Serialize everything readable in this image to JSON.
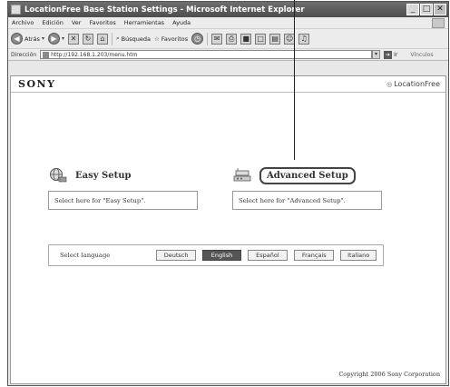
{
  "window": {
    "title": "LocationFree Base Station Settings - Microsoft Internet Explorer",
    "controls": {
      "minimize": "_",
      "maximize": "□",
      "close": "✕"
    }
  },
  "menubar": {
    "items": [
      "Archivo",
      "Edición",
      "Ver",
      "Favoritos",
      "Herramientas",
      "Ayuda"
    ]
  },
  "toolbar": {
    "back_label": "Atrás",
    "search_label": "Búsqueda",
    "favorites_label": "Favoritos"
  },
  "addressbar": {
    "label": "Dirección",
    "url": "http://192.168.1.203/menu.htm",
    "go_label": "Ir",
    "links_label": "Vínculos"
  },
  "page": {
    "brand": "SONY",
    "product_logo": "LocationFree",
    "easy_setup": {
      "title": "Easy Setup",
      "description": "Select here for \"Easy Setup\"."
    },
    "advanced_setup": {
      "title": "Advanced Setup",
      "description": "Select here for \"Advanced Setup\"."
    },
    "language": {
      "label": "Select language",
      "options": [
        "Deutsch",
        "English",
        "Español",
        "Français",
        "Italiano"
      ],
      "selected": "English"
    },
    "copyright": "Copyright 2006 Sony Corporation"
  },
  "colors": {
    "titlebar": "#5a5a5a",
    "selected_language_bg": "#555555"
  }
}
